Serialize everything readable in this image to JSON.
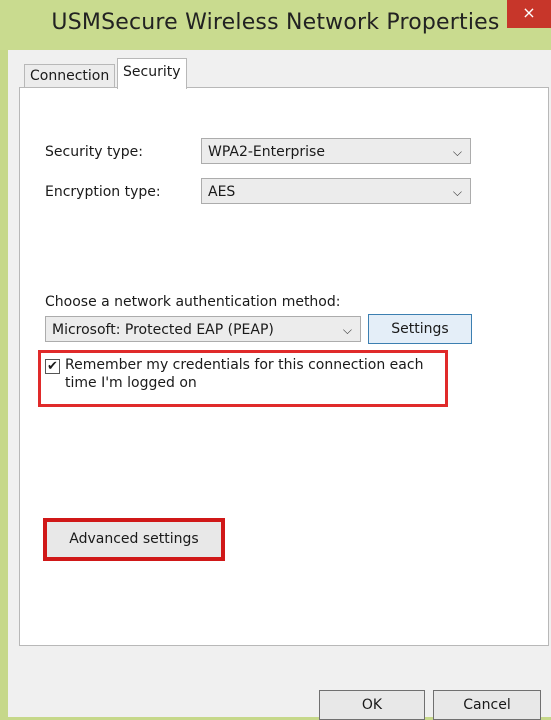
{
  "window": {
    "title": "USMSecure Wireless Network Properties",
    "close_glyph": "×"
  },
  "tabs": [
    {
      "label": "Connection",
      "active": false
    },
    {
      "label": "Security",
      "active": true
    }
  ],
  "security": {
    "security_type_label": "Security type:",
    "security_type_value": "WPA2-Enterprise",
    "encryption_type_label": "Encryption type:",
    "encryption_type_value": "AES",
    "auth_method_label": "Choose a network authentication method:",
    "auth_method_value": "Microsoft: Protected EAP (PEAP)",
    "settings_button": "Settings",
    "remember_credentials_label": "Remember my credentials for this connection each time I'm logged on",
    "remember_credentials_checked": true,
    "advanced_settings_button": "Advanced settings"
  },
  "footer": {
    "ok_button": "OK",
    "cancel_button": "Cancel"
  },
  "colors": {
    "title_bar": "#c9db8f",
    "close_button": "#c7362a",
    "highlight": "#e02a2a",
    "settings_border": "#3c7fb1"
  },
  "icons": {
    "dropdown": "chevron-down-icon",
    "check": "check-icon"
  }
}
